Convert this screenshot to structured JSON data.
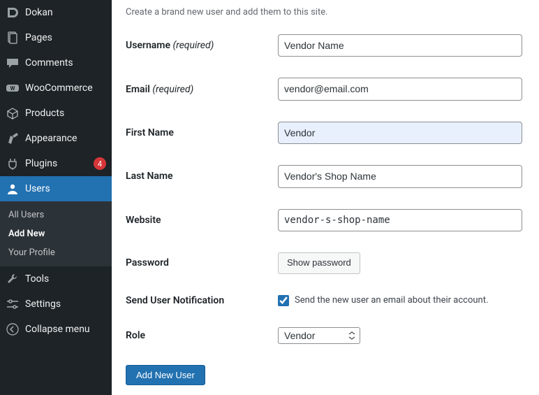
{
  "sidebar": {
    "items": [
      {
        "label": "Dokan"
      },
      {
        "label": "Pages"
      },
      {
        "label": "Comments"
      },
      {
        "label": "WooCommerce"
      },
      {
        "label": "Products"
      },
      {
        "label": "Appearance"
      },
      {
        "label": "Plugins",
        "badge": "4"
      },
      {
        "label": "Users"
      },
      {
        "label": "Tools"
      },
      {
        "label": "Settings"
      },
      {
        "label": "Collapse menu"
      }
    ],
    "subnav": {
      "all_users": "All Users",
      "add_new": "Add New",
      "your_profile": "Your Profile"
    }
  },
  "page": {
    "description": "Create a brand new user and add them to this site."
  },
  "form": {
    "username_label": "Username",
    "email_label": "Email",
    "first_name_label": "First Name",
    "last_name_label": "Last Name",
    "website_label": "Website",
    "password_label": "Password",
    "notification_label": "Send User Notification",
    "role_label": "Role",
    "required_text": "(required)",
    "username_value": "Vendor Name",
    "email_value": "vendor@email.com",
    "first_name_value": "Vendor",
    "last_name_value": "Vendor's Shop Name",
    "website_value": "vendor-s-shop-name",
    "show_password_btn": "Show password",
    "notification_checkbox_label": "Send the new user an email about their account.",
    "role_value": "Vendor",
    "submit_label": "Add New User"
  }
}
